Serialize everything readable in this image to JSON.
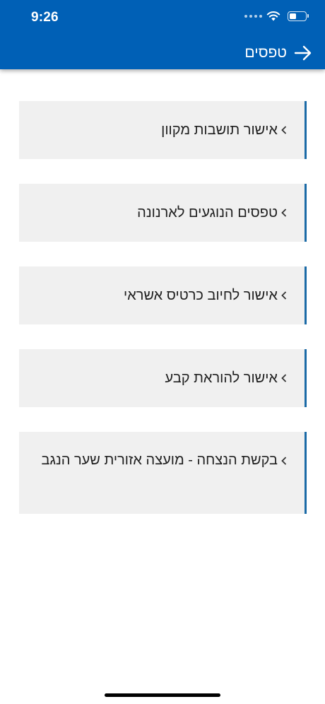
{
  "status_bar": {
    "time": "9:26"
  },
  "header": {
    "title": "טפסים",
    "back_icon": "arrow-right-icon"
  },
  "colors": {
    "header_bg": "#0060b6",
    "card_bg": "#f0f0f0",
    "card_accent": "#1a6aa6"
  },
  "forms": [
    {
      "label": "אישור תושבות מקוון"
    },
    {
      "label": "טפסים הנוגעים לארנונה"
    },
    {
      "label": "אישור לחיוב כרטיס אשראי"
    },
    {
      "label": "אישור להוראת קבע"
    },
    {
      "label": "בקשת הנצחה - מועצה אזורית שער הנגב"
    }
  ]
}
